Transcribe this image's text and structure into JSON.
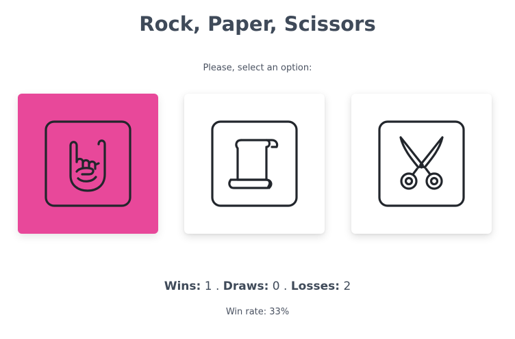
{
  "title": "Rock, Paper, Scissors",
  "prompt": "Please, select an option:",
  "options": [
    {
      "id": "rock",
      "icon": "rock-hand-icon",
      "selected": true
    },
    {
      "id": "paper",
      "icon": "paper-scroll-icon",
      "selected": false
    },
    {
      "id": "scissors",
      "icon": "scissors-icon",
      "selected": false
    }
  ],
  "stats": {
    "wins_label": "Wins:",
    "wins": "1",
    "sep1": ".",
    "draws_label": "Draws:",
    "draws": "0",
    "sep2": ".",
    "losses_label": "Losses:",
    "losses": "2"
  },
  "win_rate": "Win rate: 33%",
  "colors": {
    "selected_bg": "#e8489a",
    "card_bg": "#ffffff",
    "icon_stroke": "#22262c",
    "text": "#3f4a59"
  }
}
